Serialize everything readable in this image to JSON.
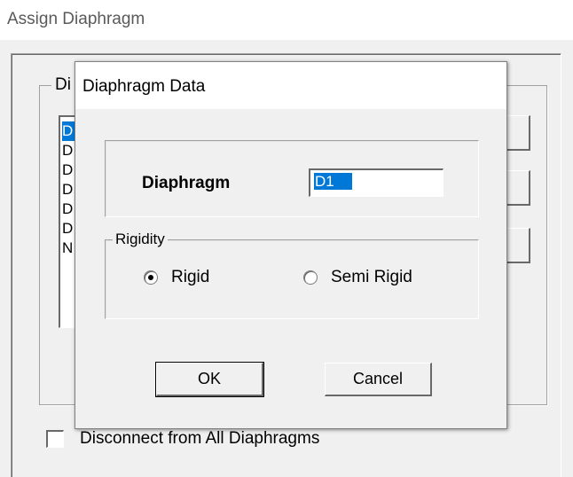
{
  "parent": {
    "title": "Assign Diaphragm",
    "group_label": "Di",
    "list_items": [
      "D",
      "D",
      "D",
      "D",
      "D",
      "D",
      "N"
    ],
    "disconnect_label": "Disconnect from All Diaphragms"
  },
  "dialog": {
    "title": "Diaphragm Data",
    "diaphragm_label": "Diaphragm",
    "diaphragm_value": "D1",
    "rigidity_label": "Rigidity",
    "options": {
      "rigid": "Rigid",
      "semi_rigid": "Semi Rigid"
    },
    "selected_option": "Rigid",
    "ok_label": "OK",
    "cancel_label": "Cancel"
  },
  "colors": {
    "selection": "#0078d7",
    "face": "#f0f0f0"
  }
}
